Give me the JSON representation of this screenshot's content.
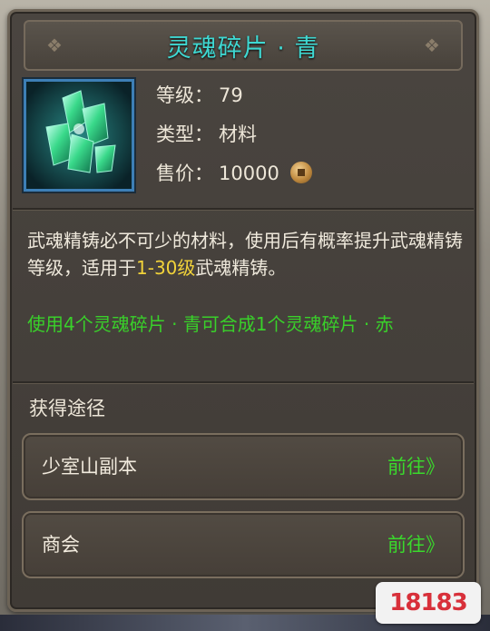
{
  "item": {
    "title": "灵魂碎片 · 青",
    "icon": "green-crystal-shard-icon",
    "stats": [
      {
        "key": "等级：",
        "value": "79"
      },
      {
        "key": "类型：",
        "value": "材料"
      },
      {
        "key": "售价：",
        "value": "10000"
      }
    ],
    "coin_icon": "copper-coin-icon"
  },
  "description": {
    "part1": "武魂精铸必不可少的材料，使用后有概率提升武魂精铸等级，适用于",
    "highlight": "1-30级",
    "part2": "武魂精铸。",
    "combine": "使用4个灵魂碎片 · 青可合成1个灵魂碎片 · 赤"
  },
  "sources": {
    "title": "获得途径",
    "items": [
      {
        "name": "少室山副本",
        "action": "前往》"
      },
      {
        "name": "商会",
        "action": "前往》"
      }
    ]
  },
  "watermark": "18183",
  "colors": {
    "title": "#3fd8d2",
    "highlight": "#f1d23a",
    "green": "#39d02a",
    "frame": "#3d7fb6"
  }
}
